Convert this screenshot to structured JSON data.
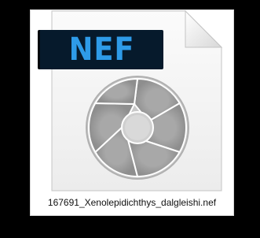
{
  "file": {
    "badge_label": "NEF",
    "filename": "167691_Xenolepidichthys_dalgleishi.nef",
    "icon": "camera-aperture-icon",
    "document_icon": "file-document-icon"
  },
  "colors": {
    "background": "#000000",
    "tile": "#ffffff",
    "badge_background": "#061a2c",
    "badge_text": "#2e9be8",
    "aperture": "#b8b8b8"
  }
}
